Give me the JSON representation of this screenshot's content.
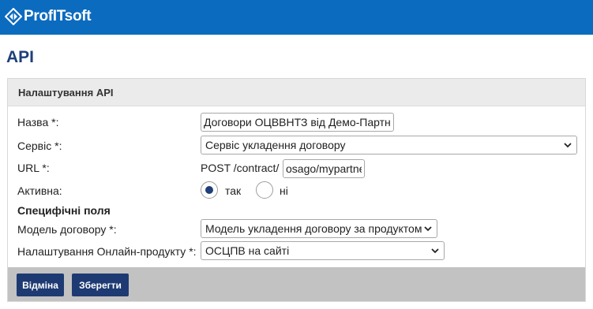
{
  "brand": {
    "name": "ProfITsoft",
    "icon": "profitsoft-logo-icon"
  },
  "page": {
    "title": "API"
  },
  "panel": {
    "title": "Налаштування API"
  },
  "form": {
    "name": {
      "label": "Назва *:",
      "value": "Договори ОЦВВНТЗ від Демо-Партнера"
    },
    "service": {
      "label": "Сервіс *:",
      "value": "Сервіс укладення договору"
    },
    "url": {
      "label": "URL *:",
      "prefix": "POST /contract/",
      "value": "osago/mypartner"
    },
    "active": {
      "label": "Активна:",
      "options": [
        "так",
        "ні"
      ],
      "selected": "так"
    },
    "specific_fields_label": "Специфічні поля",
    "contract_model": {
      "label": "Модель договору *:",
      "value": "Модель укладення договору за продуктом"
    },
    "online_product": {
      "label": "Налаштування Онлайн-продукту *:",
      "value": "ОСЦПВ на сайті"
    }
  },
  "buttons": {
    "cancel": "Відміна",
    "save": "Зберегти"
  },
  "colors": {
    "header_bar": "#0b6bbf",
    "title": "#1f3f7a",
    "button": "#1e3a72",
    "footer": "#c2c2c2"
  }
}
